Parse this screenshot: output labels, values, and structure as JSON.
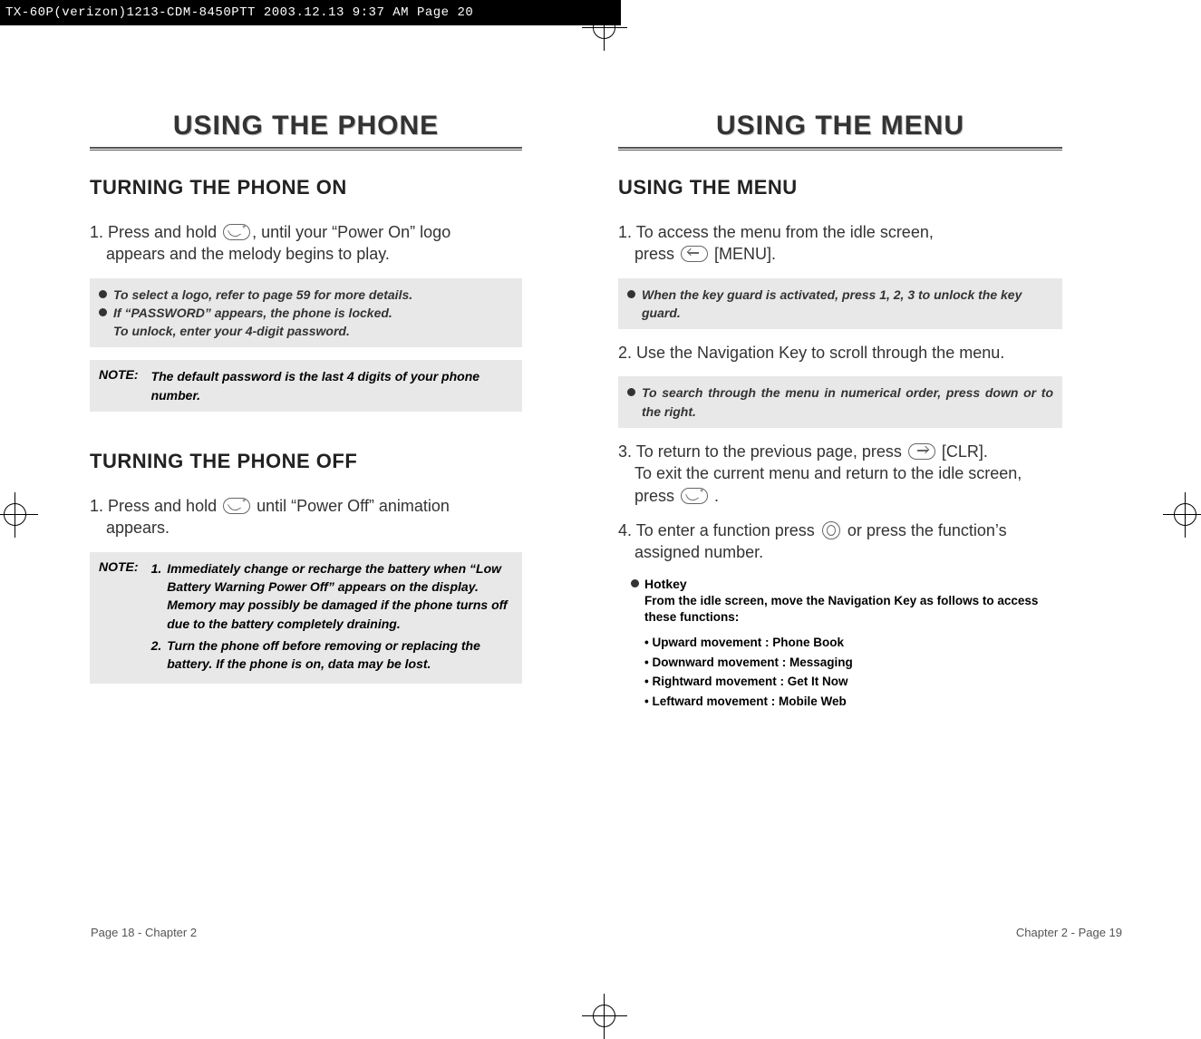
{
  "header": "TX-60P(verizon)1213-CDM-8450PTT  2003.12.13  9:37 AM  Page 20",
  "left": {
    "title": "USING THE PHONE",
    "s1": {
      "heading": "TURNING THE PHONE ON",
      "p1a": "1. Press and hold",
      "p1b": ", until your “Power On” logo",
      "p1c": "appears and the melody begins to play.",
      "box": {
        "b1": "To select a logo, refer to page 59 for more details.",
        "b2": "If “PASSWORD” appears, the phone is locked.",
        "b2b": "To unlock, enter your 4-digit password."
      },
      "note_label": "NOTE:",
      "note_text": "The default password is the last 4 digits of your phone number."
    },
    "s2": {
      "heading": "TURNING THE PHONE OFF",
      "p1a": "1. Press and hold",
      "p1b": "until “Power Off” animation",
      "p1c": "appears.",
      "note_label": "NOTE:",
      "n1": "1.",
      "n1_text": "Immediately change or recharge the battery when “Low Battery Warning Power Off” appears on the display. Memory may possibly be damaged if the phone turns off due to the battery completely draining.",
      "n2": "2.",
      "n2_text": "Turn the phone off before removing or replacing the battery. If the phone is on, data may be lost."
    },
    "footer": "Page 18 - Chapter 2"
  },
  "right": {
    "title": "USING THE MENU",
    "heading": "USING THE MENU",
    "p1a": "1. To access the menu from the idle screen,",
    "p1b": "press",
    "p1c": "[MENU].",
    "box1": "When the key guard is activated, press 1, 2, 3 to unlock the key guard.",
    "p2": "2. Use the Navigation Key to scroll through the menu.",
    "box2": "To search through the menu in numerical order, press down or to the right.",
    "p3a": "3. To return to the previous page, press",
    "p3b": "[CLR].",
    "p3c": "To exit the current menu and return to the idle screen,",
    "p3d": "press",
    "p3e": ".",
    "p4a": "4. To enter a function press",
    "p4b": "or press the function’s",
    "p4c": "assigned number.",
    "hotkey": {
      "title": "Hotkey",
      "desc": "From the idle screen, move the Navigation Key as follows to access these functions:",
      "l1": "• Upward movement : Phone Book",
      "l2": "• Downward movement : Messaging",
      "l3": "• Rightward movement : Get It Now",
      "l4": "• Leftward movement : Mobile Web"
    },
    "footer": "Chapter 2 - Page 19"
  }
}
